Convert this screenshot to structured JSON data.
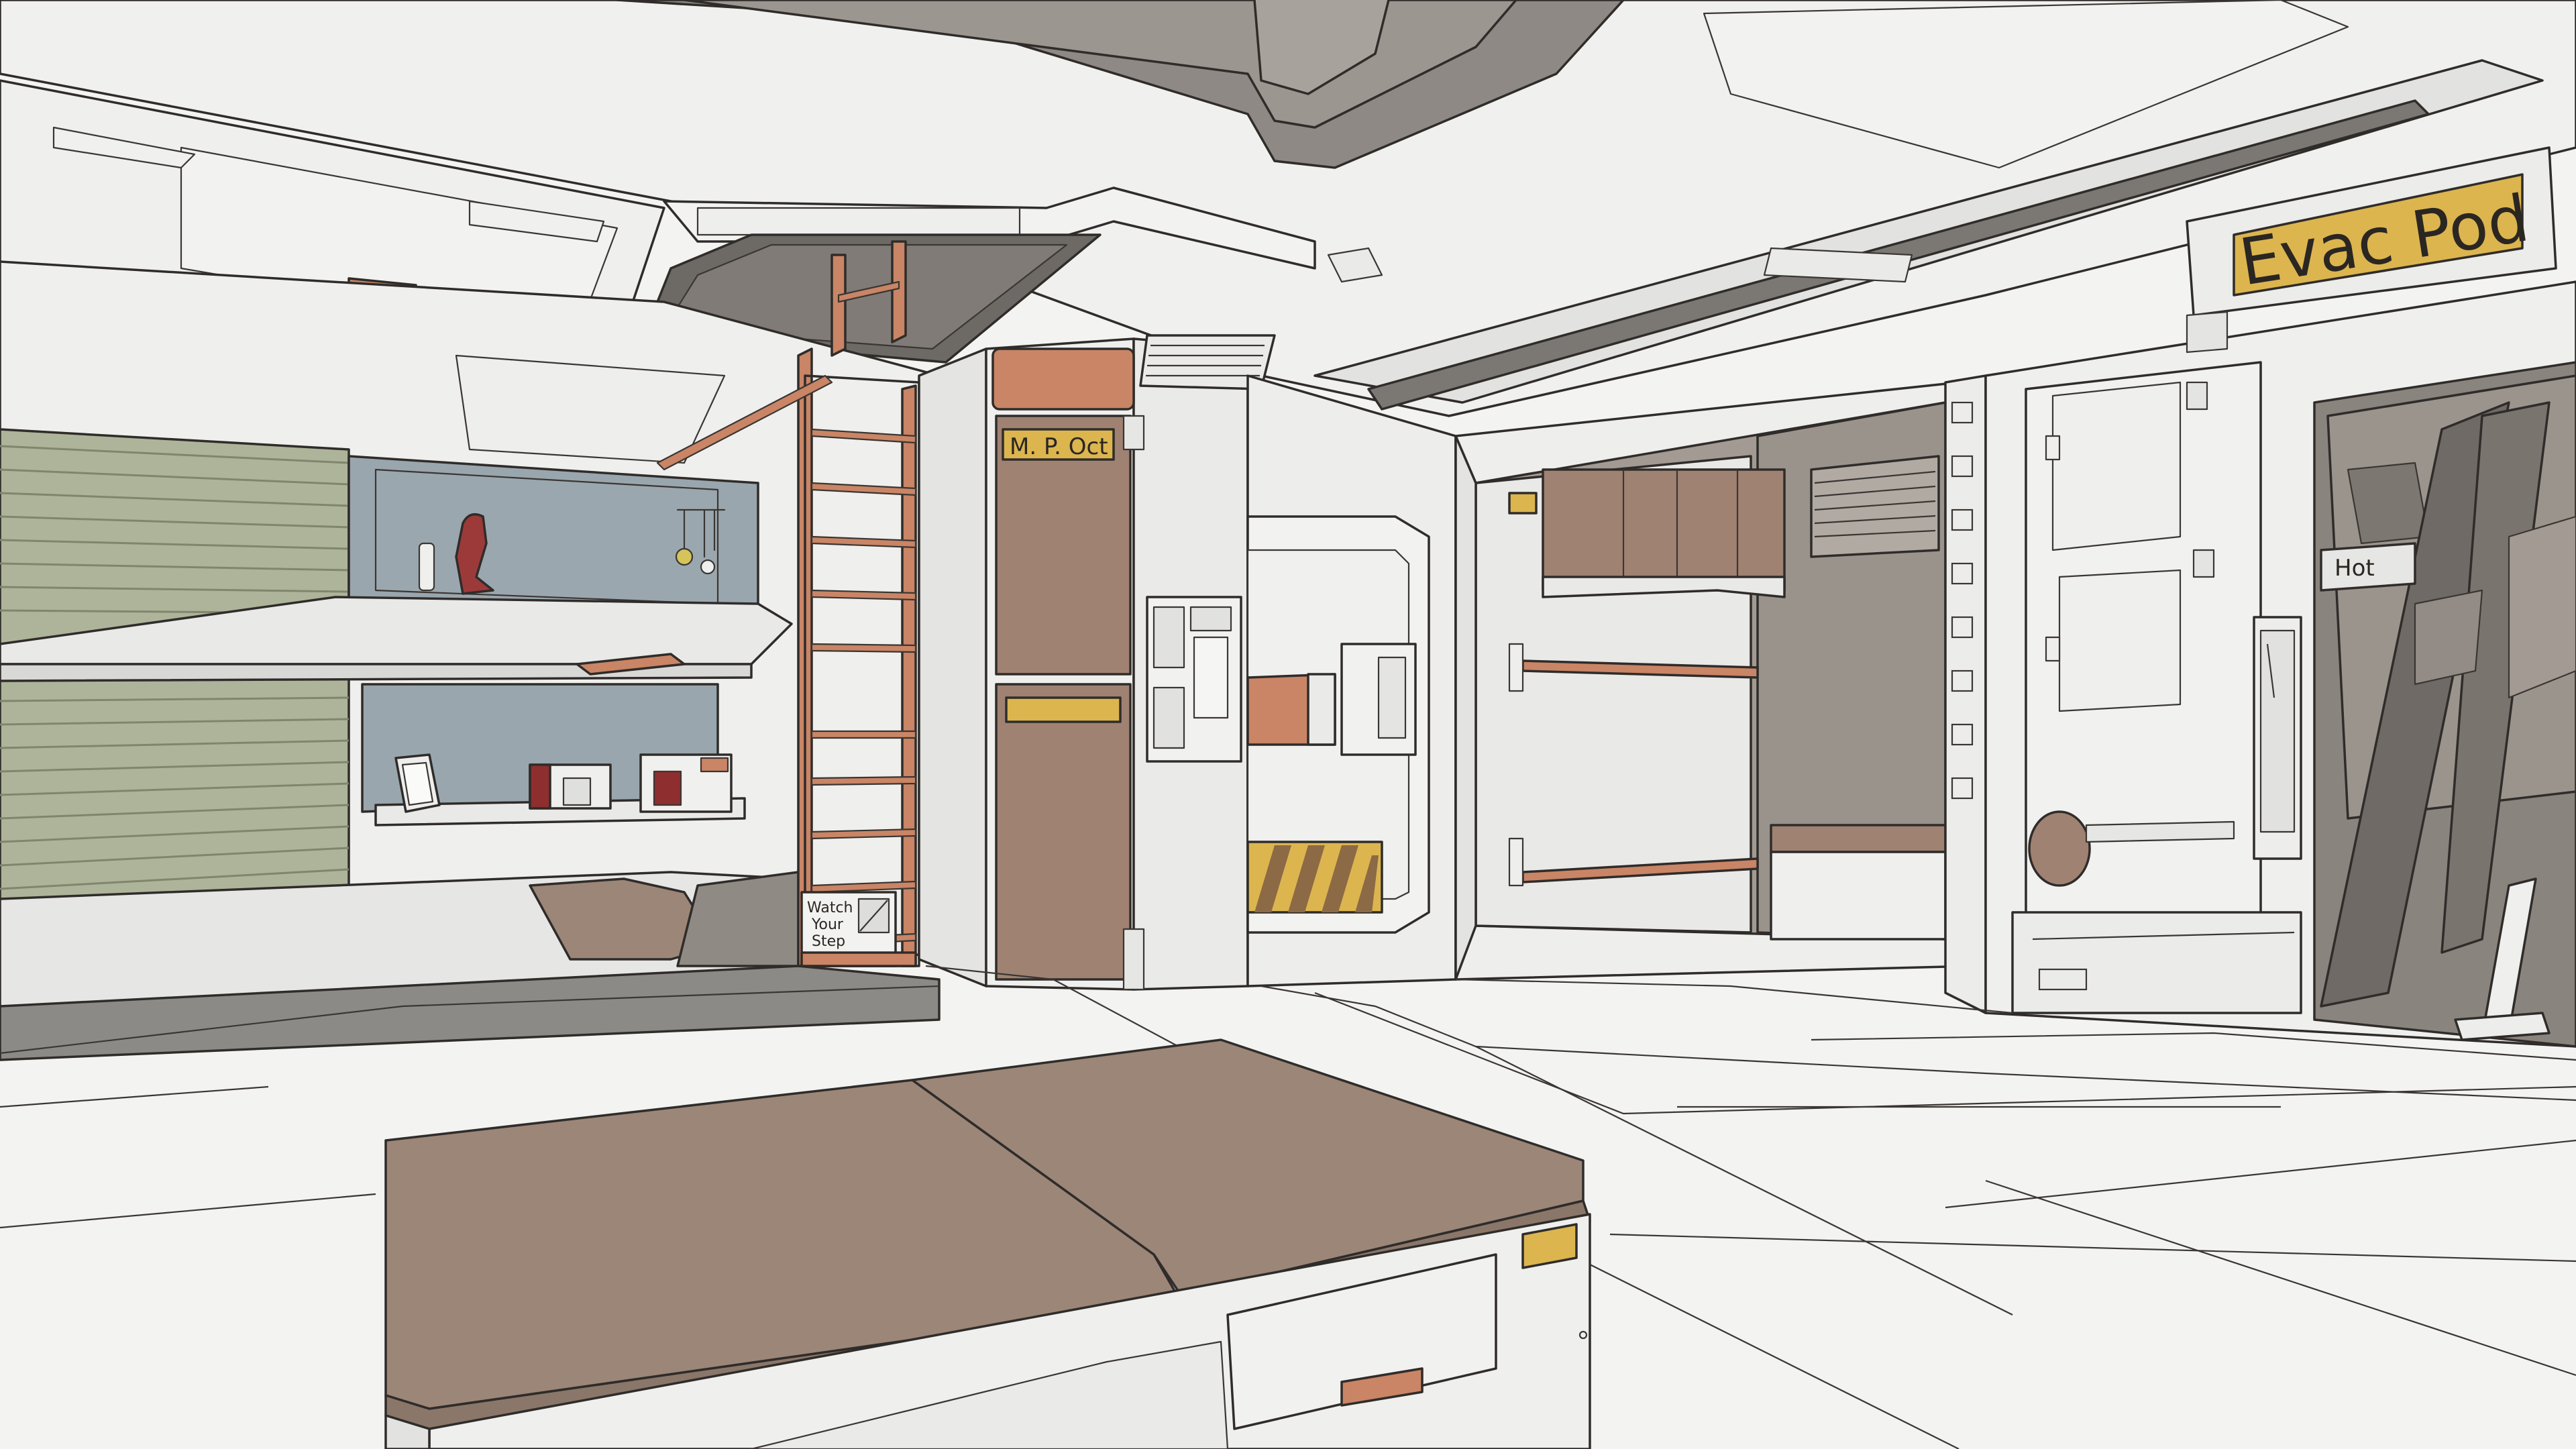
{
  "scene": {
    "colors": {
      "wall": "#eeeeec",
      "floor": "#f4f4f2",
      "shadow_wall": "#a29a93",
      "dark_ceiling": "#8f8a84",
      "accent_orange": "#c98565",
      "brown_panel": "#a08272",
      "mattress": "#9b8678",
      "bunk_blue": "#9aa6ad",
      "bunk_olive": "#aeb49a",
      "label_gold": "#dcb54f",
      "outline": "#2f2c2a"
    },
    "signs": {
      "evac_pod": "Evac Pod",
      "locker_name": "M. P. Oct",
      "hot_label": "Hot",
      "step_warning_line1": "Watch",
      "step_warning_line2": "Your",
      "step_warning_line3": "Step"
    }
  }
}
